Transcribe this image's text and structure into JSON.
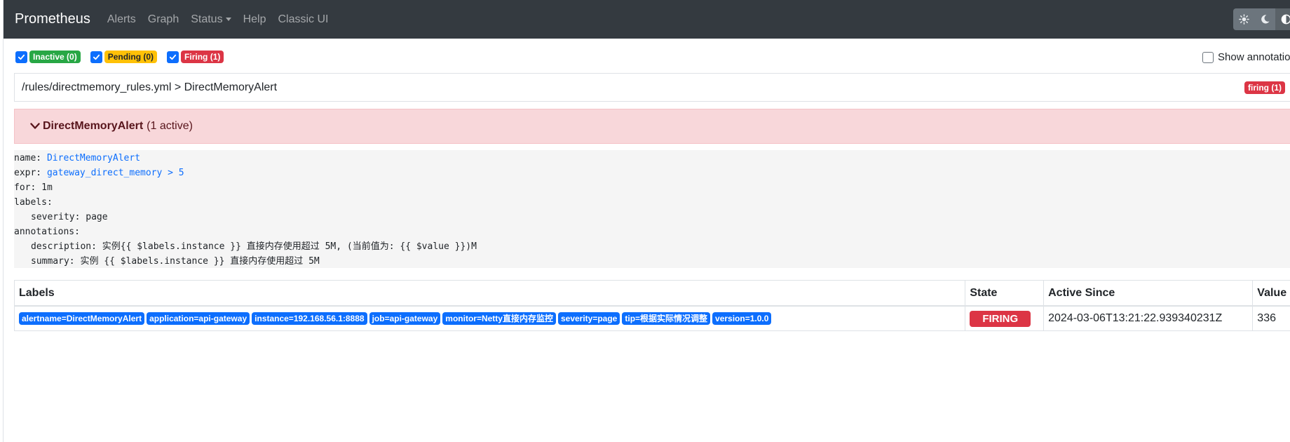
{
  "navbar": {
    "brand": "Prometheus",
    "links": [
      "Alerts",
      "Graph",
      "Status",
      "Help",
      "Classic UI"
    ],
    "theme_icons": [
      "sun-icon",
      "moon-icon",
      "contrast-icon"
    ]
  },
  "filters": {
    "inactive": "Inactive (0)",
    "pending": "Pending (0)",
    "firing": "Firing (1)",
    "show_annotations": "Show annotations"
  },
  "group": {
    "path": "/rules/directmemory_rules.yml > DirectMemoryAlert",
    "badge": "firing (1)"
  },
  "alert": {
    "name": "DirectMemoryAlert",
    "count": "(1 active)"
  },
  "rule": {
    "name_key": "name:",
    "name_val": "DirectMemoryAlert",
    "expr_key": "expr:",
    "expr_val": "gateway_direct_memory > 5",
    "for_line": "for: 1m",
    "labels_key": "labels:",
    "severity_line": "severity: page",
    "annotations_key": "annotations:",
    "description_line": "description: 实例{{ $labels.instance }} 直接内存使用超过 5M, (当前值为: {{ $value }})M",
    "summary_line": "summary: 实例 {{ $labels.instance }} 直接内存使用超过 5M"
  },
  "table": {
    "headers": [
      "Labels",
      "State",
      "Active Since",
      "Value"
    ],
    "row": {
      "labels": [
        "alertname=DirectMemoryAlert",
        "application=api-gateway",
        "instance=192.168.56.1:8888",
        "job=api-gateway",
        "monitor=Netty直接内存监控",
        "severity=page",
        "tip=根据实际情况调整",
        "version=1.0.0"
      ],
      "state": "FIRING",
      "active_since": "2024-03-06T13:21:22.939340231Z",
      "value": "336"
    }
  },
  "colors": {
    "navbar_bg": "#343a40",
    "primary": "#0d6efd",
    "danger": "#dc3545",
    "success": "#28a745",
    "warning": "#ffc107",
    "alert_bg": "#f8d7da"
  }
}
